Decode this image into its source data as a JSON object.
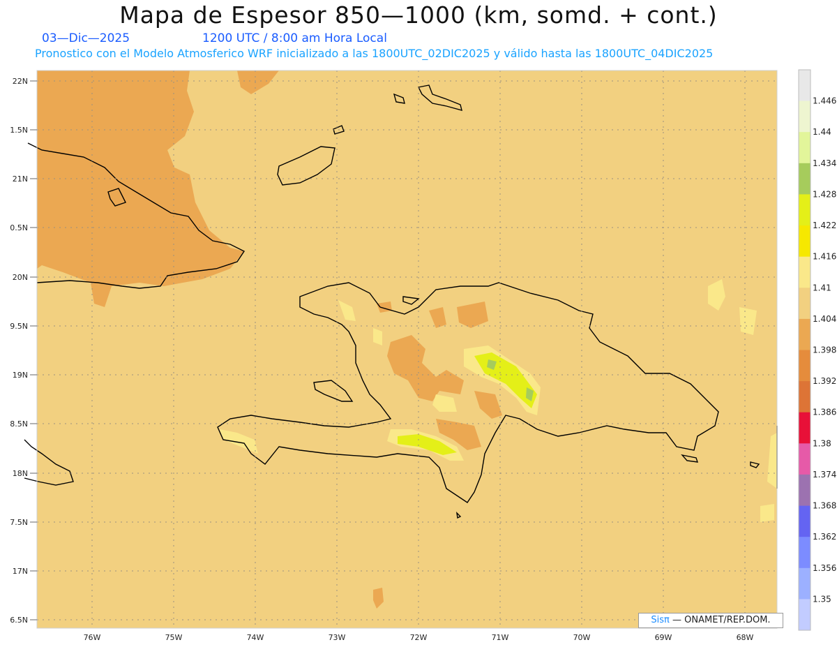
{
  "title": "Mapa de Espesor 850—1000 (km, somd. + cont.)",
  "date_line": "03—Dic—2025",
  "time_line": "1200 UTC / 8:00 am Hora Local",
  "forecast_line": "Pronostico con el Modelo Atmosferico WRF inicializado a las 1800UTC_02DIC2025 y válido hasta las  1800UTC_04DIC2025",
  "credit": {
    "brand": "Sisπ",
    "text": "— ONAMET/REP.DOM."
  },
  "lat_labels": [
    "22N",
    "1.5N",
    "21N",
    "0.5N",
    "20N",
    "9.5N",
    "19N",
    "8.5N",
    "18N",
    "7.5N",
    "17N",
    "6.5N"
  ],
  "lon_labels": [
    "76W",
    "75W",
    "74W",
    "73W",
    "72W",
    "71W",
    "70W",
    "69W",
    "68W"
  ],
  "colorbar": {
    "labels": [
      "1.446",
      "1.44",
      "1.434",
      "1.428",
      "1.422",
      "1.416",
      "1.41",
      "1.404",
      "1.398",
      "1.392",
      "1.386",
      "1.38",
      "1.374",
      "1.368",
      "1.362",
      "1.356",
      "1.35"
    ],
    "colors": [
      "#e8e8e8",
      "#eef5d0",
      "#e2f59a",
      "#a6cc5c",
      "#e4ef18",
      "#f6e800",
      "#fae88a",
      "#f2d080",
      "#eba852",
      "#e58c3c",
      "#dd7436",
      "#e81038",
      "#e65aa8",
      "#9c72b0",
      "#6464f2",
      "#7c8cff",
      "#9cb0ff",
      "#c2ccff"
    ]
  },
  "colors": {
    "background_field": "#f2d080",
    "cool_field": "#eba852",
    "warm_spot": "#fae88a",
    "peak_spot": "#e4ef18",
    "coast": "#000000"
  }
}
